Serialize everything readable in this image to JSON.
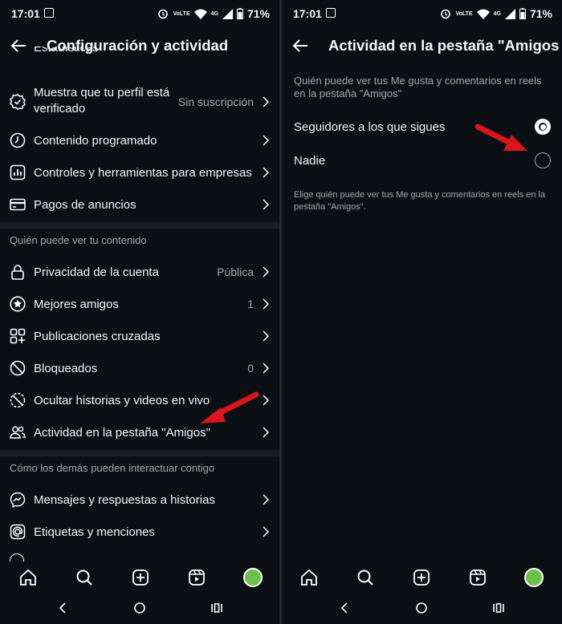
{
  "status": {
    "time": "17:01",
    "volte": "VoLTE",
    "net": "4G",
    "battery": "71%"
  },
  "left": {
    "title": "Configuración y actividad",
    "cut_top_label": "Estadísticas",
    "rows1": [
      {
        "label": "Muestra que tu perfil está",
        "label2": "verificado",
        "value": "Sin suscripción",
        "icon": "verified-badge-icon"
      },
      {
        "label": "Contenido programado",
        "value": "",
        "icon": "clock-icon"
      },
      {
        "label": "Controles y herramientas para empresas",
        "value": "",
        "icon": "bar-chart-icon"
      },
      {
        "label": "Pagos de anuncios",
        "value": "",
        "icon": "credit-card-icon"
      }
    ],
    "section2": "Quién puede ver tu contenido",
    "rows2": [
      {
        "label": "Privacidad de la cuenta",
        "value": "Pública",
        "icon": "lock-icon"
      },
      {
        "label": "Mejores amigos",
        "value": "1",
        "icon": "star-icon"
      },
      {
        "label": "Publicaciones cruzadas",
        "value": "",
        "icon": "grid-icon"
      },
      {
        "label": "Bloqueados",
        "value": "0",
        "icon": "block-icon"
      },
      {
        "label": "Ocultar historias y videos en vivo",
        "value": "",
        "icon": "hide-icon"
      },
      {
        "label": "Actividad en la pestaña \"Amigos\"",
        "value": "",
        "icon": "people-icon"
      }
    ],
    "section3": "Cómo los demás pueden interactuar contigo",
    "rows3": [
      {
        "label": "Mensajes y respuestas a historias",
        "value": "",
        "icon": "messenger-icon"
      },
      {
        "label": "Etiquetas y menciones",
        "value": "",
        "icon": "at-icon"
      }
    ]
  },
  "right": {
    "title": "Actividad en la pestaña \"Amigos",
    "question": "Quién puede ver tus Me gusta y comentarios en reels en la pestaña \"Amigos\"",
    "options": [
      {
        "label": "Seguidores a los que sigues",
        "selected": true
      },
      {
        "label": "Nadie",
        "selected": false
      }
    ],
    "footnote": "Elige quién puede ver tus Me gusta y comentarios en reels en la pestaña \"Amigos\"."
  },
  "colors": {
    "arrow": "#d9161c",
    "bg": "#0c0f14",
    "secondary": "#a8a8a8"
  }
}
